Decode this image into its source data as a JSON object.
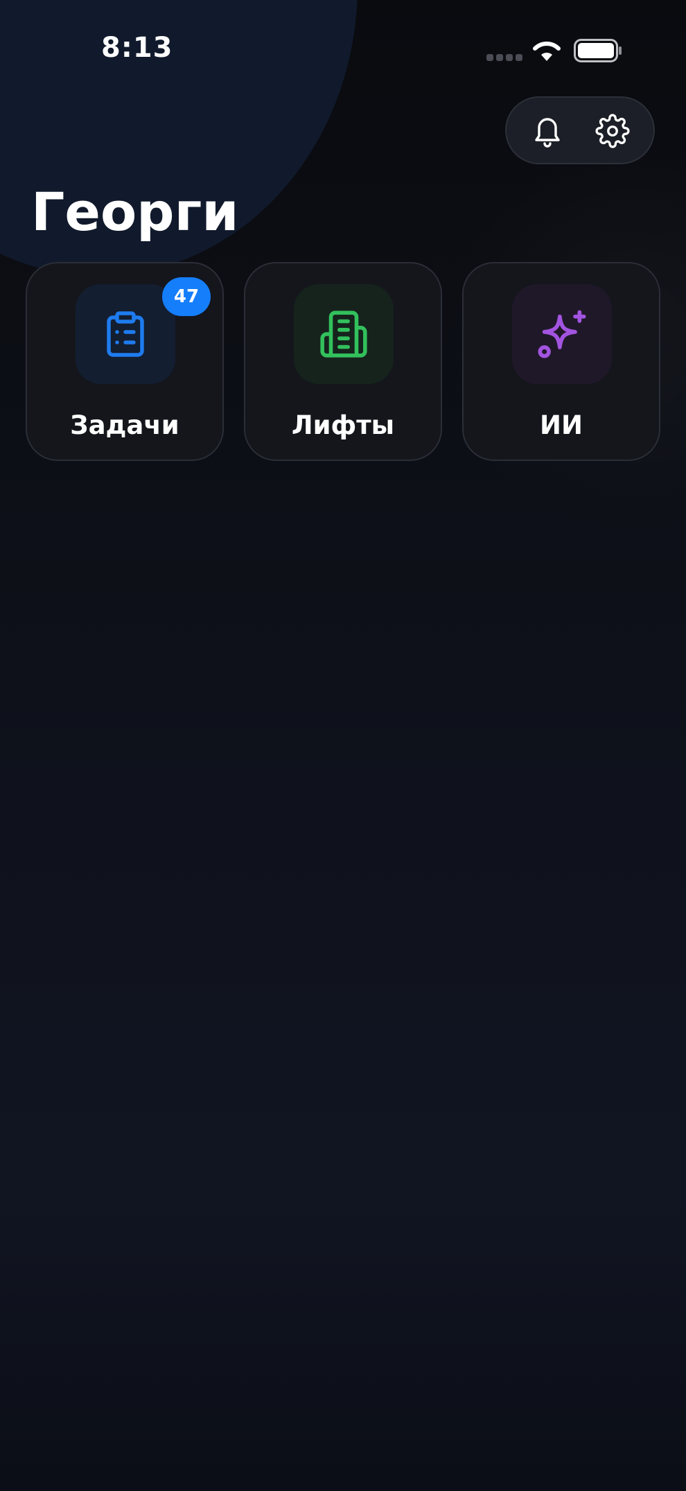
{
  "status_bar": {
    "time": "8:13",
    "icons": [
      "cellular-signal-icon",
      "wifi-icon",
      "battery-icon"
    ]
  },
  "header": {
    "title": "Георги",
    "actions": [
      {
        "icon": "bell-icon"
      },
      {
        "icon": "gear-icon"
      }
    ]
  },
  "tiles": [
    {
      "label": "Задачи",
      "icon": "clipboard-list-icon",
      "color": "#1f7cf0",
      "badge": "47"
    },
    {
      "label": "Лифты",
      "icon": "building-icon",
      "color": "#32c05c"
    },
    {
      "label": "ИИ",
      "icon": "sparkles-icon",
      "color": "#a254e0"
    }
  ],
  "colors": {
    "background": "#0b0d12",
    "badge": "#157efb"
  }
}
